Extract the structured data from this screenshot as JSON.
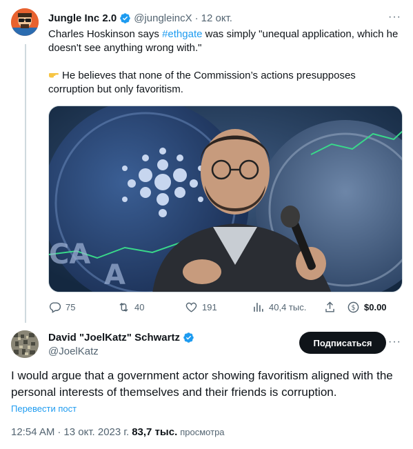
{
  "parent": {
    "name": "Jungle Inc 2.0",
    "handle": "@jungleincX",
    "separator": "·",
    "time": "12 окт.",
    "text_before_hashtag": "Charles Hoskinson says ",
    "hashtag": "#ethgate",
    "text_after_hashtag": " was simply \"unequal application, which he doesn't see anything wrong with.\"",
    "text_second_paragraph": "He believes that none of the Commission’s actions presupposes corruption but only favoritism.",
    "media_overlay_text_1": "CA",
    "media_overlay_text_2": "A",
    "stats": {
      "replies": "75",
      "reposts": "40",
      "likes": "191",
      "views": "40,4 тыс.",
      "tips": "$0.00"
    }
  },
  "reply": {
    "name": "David \"JoelKatz\" Schwartz",
    "handle": "@JoelKatz",
    "follow_label": "Подписаться",
    "text": "I would argue that a government actor showing favoritism aligned with the personal interests of themselves and their friends is corruption.",
    "translate_label": "Перевести пост",
    "time": "12:54 AM",
    "separator": "·",
    "date": "13 окт. 2023 г.",
    "views_count": "83,7 тыс.",
    "views_label": "просмотра"
  },
  "icons": {
    "verified": "verified-badge-icon",
    "more": "more-icon",
    "reply": "reply-icon",
    "repost": "repost-icon",
    "like": "like-icon",
    "views": "views-icon",
    "share": "share-icon",
    "tip": "tip-icon"
  },
  "colors": {
    "accent": "#1d9bf0",
    "text": "#0f1419",
    "muted": "#536471",
    "border": "#cfd9de",
    "follow_bg": "#0f1419"
  }
}
